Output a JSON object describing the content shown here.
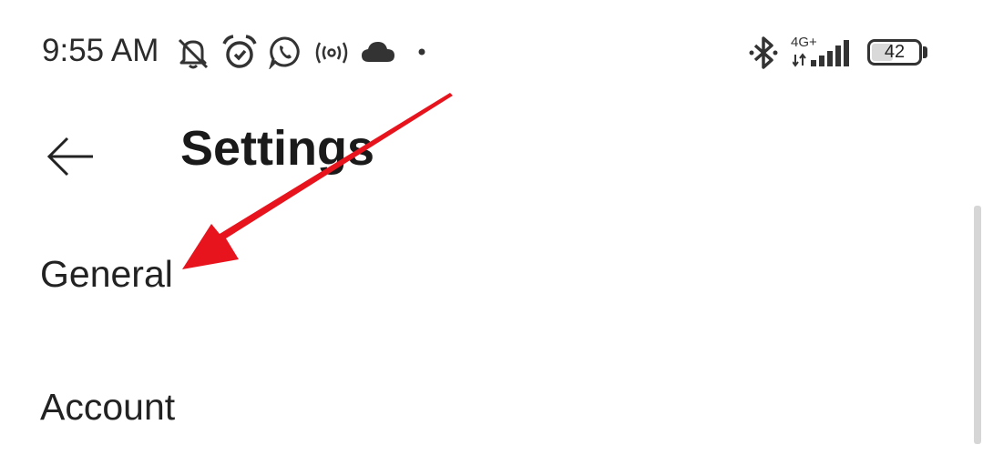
{
  "status_bar": {
    "time": "9:55 AM",
    "network_type": "4G+",
    "battery_level": "42",
    "icons": [
      "mute-icon",
      "alarm-icon",
      "whatsapp-icon",
      "hotspot-icon",
      "cloud-icon",
      "dot-icon",
      "bluetooth-icon",
      "signal-icon",
      "battery-icon"
    ]
  },
  "header": {
    "back_icon": "arrow-left-icon",
    "title": "Settings"
  },
  "settings_items": [
    {
      "label": "General"
    },
    {
      "label": "Account"
    }
  ],
  "annotation": {
    "type": "arrow",
    "color": "#e8141d",
    "points_to": "General"
  }
}
